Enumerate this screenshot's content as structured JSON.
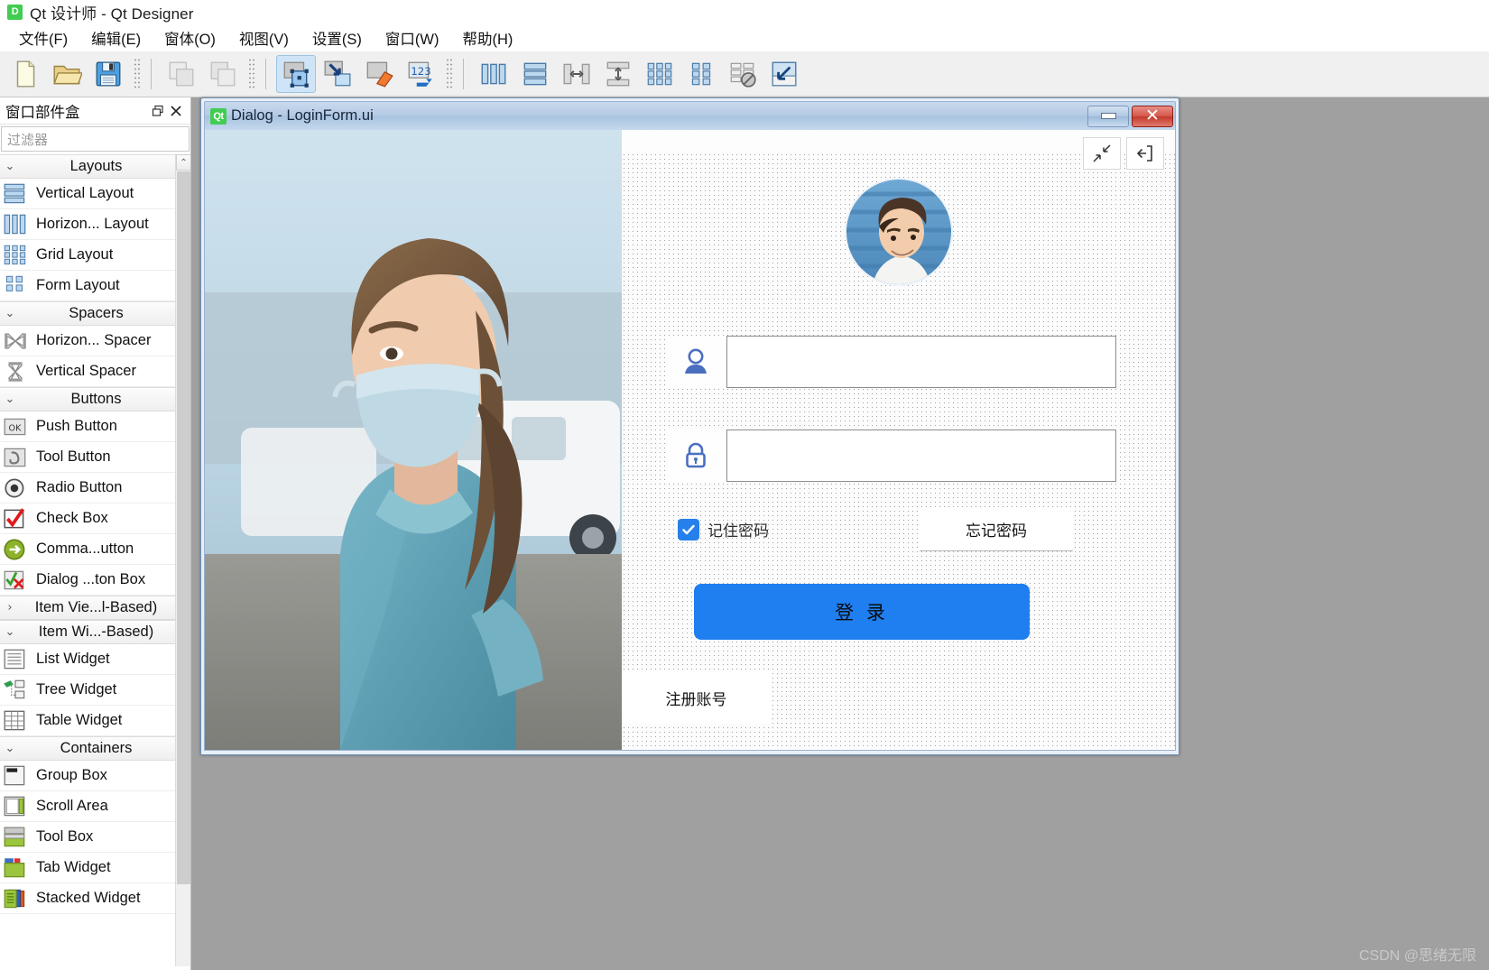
{
  "window": {
    "icon": "qt-designer-icon",
    "title": "Qt 设计师 - Qt Designer",
    "badge_text": "D"
  },
  "menubar": {
    "items": [
      {
        "label": "文件(F)",
        "name": "menu-file"
      },
      {
        "label": "编辑(E)",
        "name": "menu-edit"
      },
      {
        "label": "窗体(O)",
        "name": "menu-form"
      },
      {
        "label": "视图(V)",
        "name": "menu-view"
      },
      {
        "label": "设置(S)",
        "name": "menu-settings"
      },
      {
        "label": "窗口(W)",
        "name": "menu-window"
      },
      {
        "label": "帮助(H)",
        "name": "menu-help"
      }
    ]
  },
  "toolbar": {
    "groups": [
      {
        "buttons": [
          {
            "icon": "new-file-icon",
            "active": false
          },
          {
            "icon": "open-folder-icon",
            "active": false
          },
          {
            "icon": "save-disk-icon",
            "active": false
          }
        ]
      },
      {
        "buttons": [
          {
            "icon": "undo-icon",
            "active": false
          },
          {
            "icon": "redo-icon",
            "active": false
          }
        ]
      },
      {
        "buttons": [
          {
            "icon": "edit-widgets-icon",
            "active": true
          },
          {
            "icon": "edit-signals-slots-icon",
            "active": false
          },
          {
            "icon": "edit-buddies-icon",
            "active": false
          },
          {
            "icon": "edit-tab-order-icon",
            "active": false
          }
        ]
      },
      {
        "buttons": [
          {
            "icon": "layout-horizontally-icon",
            "active": false
          },
          {
            "icon": "layout-vertically-icon",
            "active": false
          },
          {
            "icon": "layout-splitter-horizontal-icon",
            "active": false
          },
          {
            "icon": "layout-splitter-vertical-icon",
            "active": false
          },
          {
            "icon": "layout-grid-icon",
            "active": false
          },
          {
            "icon": "layout-form-icon",
            "active": false
          },
          {
            "icon": "break-layout-icon",
            "active": false
          },
          {
            "icon": "adjust-size-icon",
            "active": false
          }
        ]
      }
    ]
  },
  "widgetbox": {
    "title": "窗口部件盒",
    "float_icon": "restore-icon",
    "close_icon": "close-icon",
    "filter_placeholder": "过滤器",
    "filter_value": "",
    "groups": [
      {
        "name": "Layouts",
        "expanded": true,
        "items": [
          {
            "label": "Vertical Layout",
            "icon": "vertical-layout-icon"
          },
          {
            "label": "Horizon... Layout",
            "icon": "horizontal-layout-icon"
          },
          {
            "label": "Grid Layout",
            "icon": "grid-layout-icon"
          },
          {
            "label": "Form Layout",
            "icon": "form-layout-icon"
          }
        ]
      },
      {
        "name": "Spacers",
        "expanded": true,
        "items": [
          {
            "label": "Horizon... Spacer",
            "icon": "horizontal-spacer-icon"
          },
          {
            "label": "Vertical Spacer",
            "icon": "vertical-spacer-icon"
          }
        ]
      },
      {
        "name": "Buttons",
        "expanded": true,
        "items": [
          {
            "label": "Push Button",
            "icon": "push-button-icon"
          },
          {
            "label": "Tool Button",
            "icon": "tool-button-icon"
          },
          {
            "label": "Radio Button",
            "icon": "radio-button-icon"
          },
          {
            "label": "Check Box",
            "icon": "check-box-icon"
          },
          {
            "label": "Comma...utton",
            "icon": "command-link-button-icon"
          },
          {
            "label": "Dialog ...ton Box",
            "icon": "dialog-button-box-icon"
          }
        ]
      },
      {
        "name": "Item Vie...l-Based)",
        "expanded": false,
        "items": []
      },
      {
        "name": "Item Wi...-Based)",
        "expanded": true,
        "items": [
          {
            "label": "List Widget",
            "icon": "list-widget-icon"
          },
          {
            "label": "Tree Widget",
            "icon": "tree-widget-icon"
          },
          {
            "label": "Table Widget",
            "icon": "table-widget-icon"
          }
        ]
      },
      {
        "name": "Containers",
        "expanded": true,
        "items": [
          {
            "label": "Group Box",
            "icon": "group-box-icon"
          },
          {
            "label": "Scroll Area",
            "icon": "scroll-area-icon"
          },
          {
            "label": "Tool Box",
            "icon": "tool-box-icon"
          },
          {
            "label": "Tab Widget",
            "icon": "tab-widget-icon"
          },
          {
            "label": "Stacked Widget",
            "icon": "stacked-widget-icon"
          }
        ]
      }
    ]
  },
  "dialog": {
    "badge_text": "Qt",
    "title": "Dialog - LoginForm.ui",
    "minimize_label": "",
    "close_label": "✕",
    "form": {
      "tool_collapse_icon": "collapse-arrows-icon",
      "tool_exit_icon": "exit-arrow-icon",
      "avatar_icon": "user-avatar-photo",
      "username": {
        "icon": "person-icon",
        "value": "",
        "placeholder": ""
      },
      "password": {
        "icon": "lock-icon",
        "value": "",
        "placeholder": ""
      },
      "remember": {
        "checked": true,
        "label": "记住密码",
        "check_icon": "checkmark-icon"
      },
      "forgot_label": "忘记密码",
      "login_label": "登 录",
      "register_label": "注册账号"
    }
  },
  "colors": {
    "accent_blue": "#1f7ff0",
    "icon_blue": "#4a6fbf",
    "checkbox_blue": "#2680eb",
    "qt_green": "#41cd52",
    "canvas_gray": "#a0a0a0",
    "titlebar_blue": "#b4cbe4"
  },
  "watermark": "CSDN @思绪无限"
}
